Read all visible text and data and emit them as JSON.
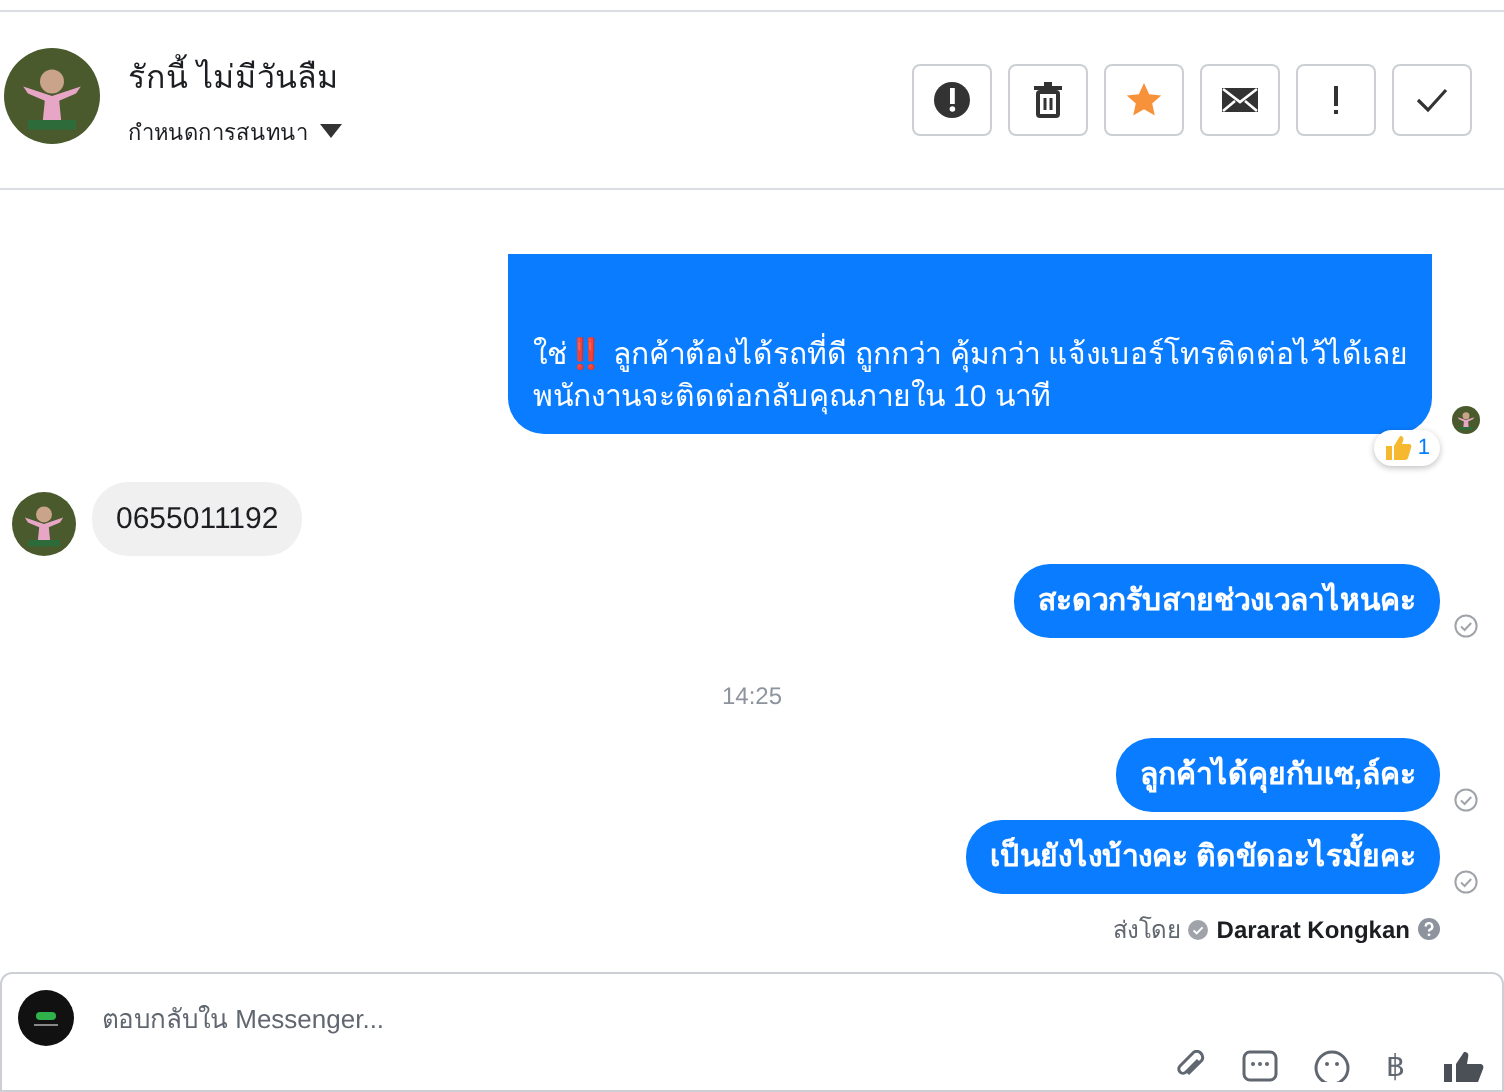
{
  "header": {
    "contact_name": "รักนี้ ไม่มีวันลืม",
    "subtitle": "กำหนดการสนทนา"
  },
  "messages": [
    {
      "kind": "outgoing",
      "lines": [
        "ใช่‼️ ลูกค้าต้องได้รถที่ดี ถูกกว่า คุ้มกว่า แจ้งเบอร์โทรติดต่อไว้ได้เลย",
        "พนักงานจะติดต่อกลับคุณภายใน 10 นาที"
      ],
      "reaction_count": "1",
      "seen": true,
      "truncated_top": true
    },
    {
      "kind": "incoming",
      "lines": [
        "0655011192"
      ]
    },
    {
      "kind": "outgoing",
      "lines": [
        "สะดวกรับสายช่วงเวลาไหนคะ"
      ],
      "seen": false
    },
    {
      "kind": "timestamp",
      "lines": [
        "14:25"
      ]
    },
    {
      "kind": "outgoing",
      "lines": [
        "ลูกค้าได้คุยกับเซ,ล์คะ"
      ],
      "seen": false
    },
    {
      "kind": "outgoing",
      "lines": [
        "เป็นยังไงบ้างคะ ติดขัดอะไรมั้ยคะ"
      ],
      "seen": false
    }
  ],
  "sent_by": {
    "label": "ส่งโดย",
    "name": "Dararat Kongkan"
  },
  "composer": {
    "placeholder": "ตอบกลับใน Messenger...",
    "currency_symbol": "฿"
  }
}
